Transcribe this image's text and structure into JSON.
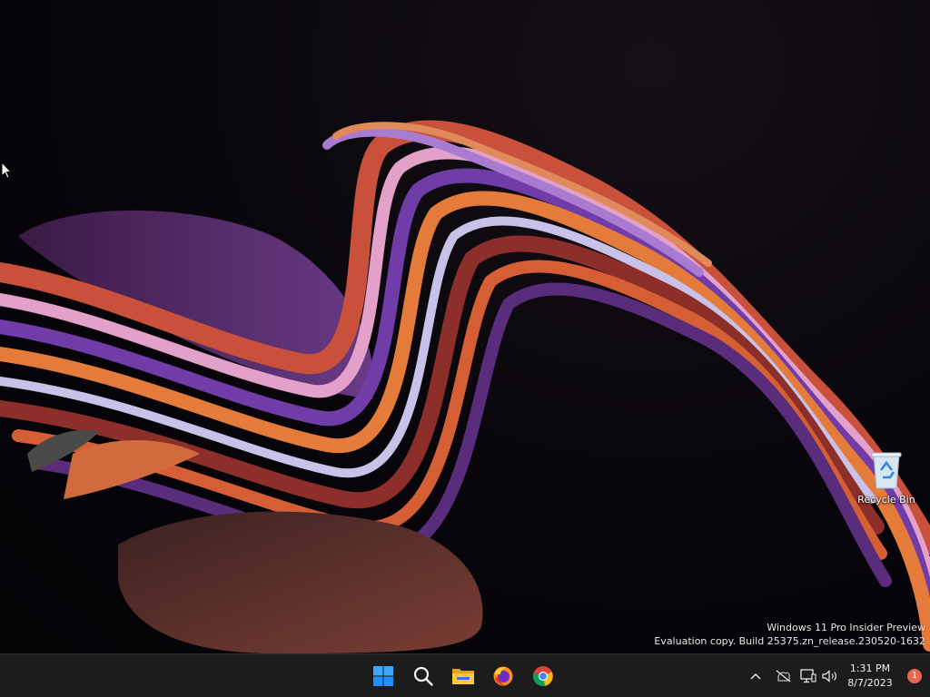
{
  "desktop": {
    "icons": [
      {
        "label": "Recycle Bin",
        "icon": "recycle-bin-icon"
      }
    ],
    "watermark": {
      "line1": "Windows 11 Pro Insider Preview",
      "line2": "Evaluation copy. Build 25375.zn_release.230520-1632"
    }
  },
  "taskbar": {
    "apps": [
      {
        "name": "Start",
        "icon": "windows-start-icon"
      },
      {
        "name": "Search",
        "icon": "search-icon"
      },
      {
        "name": "File Explorer",
        "icon": "file-explorer-icon"
      },
      {
        "name": "Firefox",
        "icon": "firefox-icon"
      },
      {
        "name": "Chrome",
        "icon": "chrome-icon"
      }
    ],
    "tray": {
      "chevron_icon": "chevron-up-icon",
      "network_icon": "network-disconnected-icon",
      "display_icon": "display-icon",
      "volume_icon": "volume-icon",
      "time": "1:31 PM",
      "date": "8/7/2023",
      "notification_count": "1"
    }
  },
  "colors": {
    "taskbar_bg": "#1c1c1c",
    "start_blue": "#1e90ff",
    "badge": "#e8654f"
  }
}
